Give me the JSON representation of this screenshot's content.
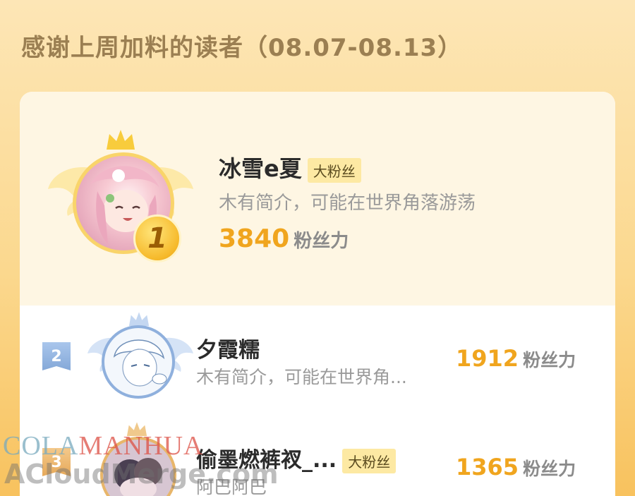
{
  "page_title": "感谢上周加料的读者（08.07-08.13）",
  "colors": {
    "accent": "#f0a51e",
    "badge_bg": "#fde9a3",
    "rank2": "#8fb0dd",
    "gold": "#f6b92a"
  },
  "first": {
    "rank": "1",
    "name": "冰雪e夏",
    "badge": "大粉丝",
    "bio": "木有简介，可能在世界角落游荡",
    "score": "3840",
    "unit": "粉丝力",
    "avatar_icon": "anime-girl-avatar",
    "crown_icon": "crown-icon"
  },
  "others": [
    {
      "rank": "2",
      "name": "夕霞糯",
      "badge": "",
      "bio": "木有简介，可能在世界角...",
      "score": "1912",
      "unit": "粉丝力",
      "avatar_icon": "anime-boy-avatar"
    },
    {
      "rank": "3",
      "name": "偷墨燃裤衩_...",
      "badge": "大粉丝",
      "bio": "阿巴阿巴",
      "score": "1365",
      "unit": "粉丝力",
      "avatar_icon": "couple-avatar"
    }
  ],
  "watermark": {
    "line1_a": "COLA",
    "line1_b": "MANHUA",
    "line2": "ACloudMerge.com"
  }
}
